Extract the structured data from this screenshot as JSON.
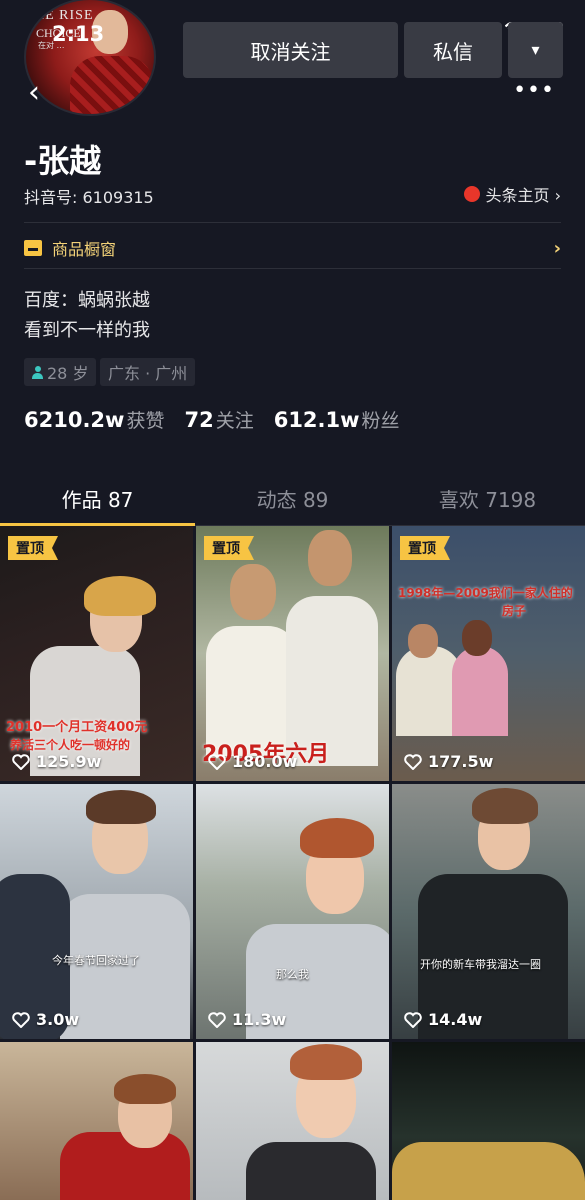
{
  "status_bar": {
    "time": "2:13"
  },
  "avatar": {
    "line1": "HE RISE",
    "line2": "CHOICE",
    "line3": "在对 …"
  },
  "header": {
    "unfollow_label": "取消关注",
    "message_label": "私信",
    "more_label": "▾",
    "back_label": "‹",
    "menu_label": "•••"
  },
  "profile": {
    "name": "-张越",
    "douyin_id": "抖音号: 6109315",
    "toutiao_label": "头条主页 ›",
    "shop_label": "商品橱窗",
    "bio_line1": "百度：蜗蜗张越",
    "bio_line2": "看到不一样的我",
    "age": "28 岁",
    "location": "广东 · 广州"
  },
  "stats": [
    {
      "value": "6210.2w",
      "label": "获赞"
    },
    {
      "value": "72",
      "label": "关注"
    },
    {
      "value": "612.1w",
      "label": "粉丝"
    }
  ],
  "tabs": [
    {
      "label": "作品 87"
    },
    {
      "label": "动态 89"
    },
    {
      "label": "喜欢 7198"
    }
  ],
  "pin_label": "置顶",
  "videos": [
    {
      "likes": "125.9w",
      "caption1": "2010一个月工资400元",
      "caption2": "养活三个人吃一顿好的"
    },
    {
      "likes": "180.0w",
      "caption1": "2005年六月",
      "caption2": ""
    },
    {
      "likes": "177.5w",
      "caption1": "1998年—2009我们一家人住的",
      "caption2": "房子"
    },
    {
      "likes": "3.0w",
      "caption1": "今年春节回家过了",
      "caption2": ""
    },
    {
      "likes": "11.3w",
      "caption1": "那么我",
      "caption2": ""
    },
    {
      "likes": "14.4w",
      "caption1": "开你的新车带我溜达一圈",
      "caption2": ""
    },
    {
      "likes": "",
      "caption1": "",
      "caption2": ""
    },
    {
      "likes": "",
      "caption1": "",
      "caption2": ""
    },
    {
      "likes": "",
      "caption1": "",
      "caption2": ""
    }
  ],
  "colors": {
    "bg": "#161823",
    "accent": "#f7c443",
    "button": "#393b44",
    "muted": "#8d8f98"
  }
}
